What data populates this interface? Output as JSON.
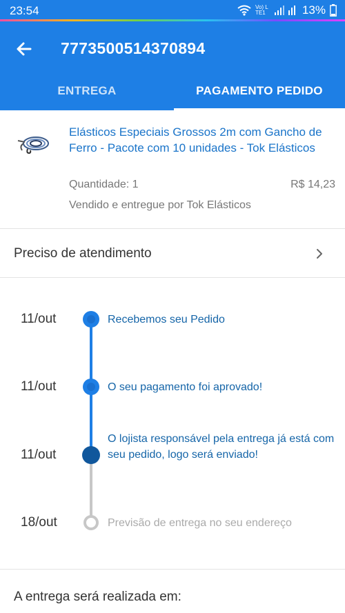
{
  "status_bar": {
    "time": "23:54",
    "network": "Vo) LTE1",
    "battery": "13%"
  },
  "header": {
    "order_id": "7773500514370894",
    "tabs": [
      {
        "label": "ENTREGA",
        "active": false
      },
      {
        "label": "PAGAMENTO PEDIDO",
        "active": true
      }
    ]
  },
  "product": {
    "title": "Elásticos Especiais Grossos 2m com Gancho de Ferro - Pacote com 10 unidades - Tok Elásticos",
    "quantity": "Quantidade: 1",
    "price": "R$ 14,23",
    "seller": "Vendido e entregue por Tok Elásticos"
  },
  "help": {
    "label": "Preciso de atendimento"
  },
  "timeline": [
    {
      "date": "11/out",
      "text": "Recebemos seu Pedido",
      "state": "done"
    },
    {
      "date": "11/out",
      "text": "O seu pagamento foi aprovado!",
      "state": "done"
    },
    {
      "date": "11/out",
      "text": "O lojista responsável pela entrega já está com seu pedido, logo será enviado!",
      "state": "current"
    },
    {
      "date": "18/out",
      "text": "Previsão de entrega no seu endereço",
      "state": "pending"
    }
  ],
  "delivery": {
    "title": "A entrega será realizada em:"
  },
  "colors": {
    "primary": "#1e7fe5",
    "link": "#1a74c9",
    "current_dot": "#10579c",
    "pending": "#c7c7c7"
  }
}
